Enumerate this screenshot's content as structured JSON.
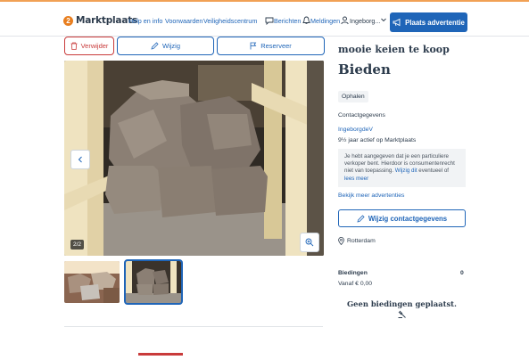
{
  "header": {
    "logo_number": "2",
    "logo_text": "Marktplaats",
    "nav": [
      "Help en info",
      "Voorwaarden",
      "Veiligheidscentrum"
    ],
    "messages": "Berichten",
    "notifications": "Meldingen",
    "user": "Ingeborg...",
    "place_ad": "Plaats advertentie"
  },
  "actions": {
    "delete": "Verwijder",
    "edit": "Wijzig",
    "reserve": "Reserveer"
  },
  "gallery": {
    "counter": "2/2"
  },
  "listing": {
    "title": "mooie keien te koop",
    "price": "Bieden",
    "tag": "Ophalen"
  },
  "contact": {
    "heading": "Contactgegevens",
    "seller": "IngeborgdeV",
    "years_active": "9½ jaar actief op Marktplaats",
    "notice_text": "Je hebt aangegeven dat je een particuliere verkoper bent. Hierdoor is consumentenrecht niet van toepassing.",
    "notice_link1": "Wijzig dit",
    "notice_mid": "eventueel of",
    "notice_link2": "lees meer",
    "more_ads": "Bekijk meer advertenties",
    "edit_contact": "Wijzig contactgegevens",
    "location": "Rotterdam"
  },
  "bids": {
    "heading": "Biedingen",
    "count": "0",
    "from": "Vanaf € 0,00",
    "empty": "Geen biedingen geplaatst."
  },
  "colors": {
    "brand_blue": "#1f65b8",
    "danger_red": "#c93b3b",
    "logo_orange": "#e87e1f"
  }
}
